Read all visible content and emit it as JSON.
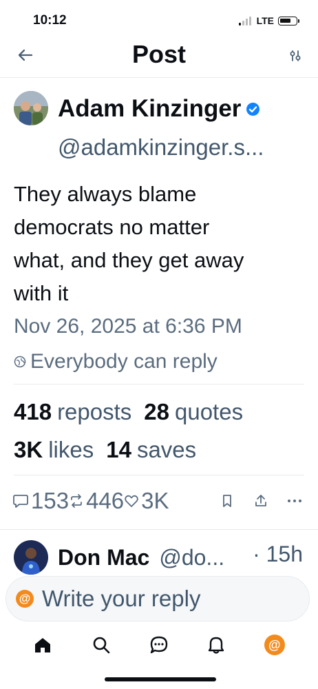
{
  "status_bar": {
    "time": "10:12",
    "network": "LTE"
  },
  "header": {
    "title": "Post"
  },
  "post": {
    "author_name": "Adam Kinzinger",
    "handle": "@adamkinzinger.s...",
    "text_lines": [
      "They always blame",
      "democrats no matter",
      "what, and they get away",
      "with it"
    ],
    "timestamp": "Nov 26, 2025 at 6:36 PM",
    "reply_permission": "Everybody can reply"
  },
  "stats": {
    "reposts_count": "418",
    "reposts_label": "reposts",
    "quotes_count": "28",
    "quotes_label": "quotes",
    "likes_count": "3K",
    "likes_label": "likes",
    "saves_count": "14",
    "saves_label": "saves"
  },
  "actions": {
    "replies": "153",
    "reposts": "446",
    "likes": "3K"
  },
  "reply_preview": {
    "name": "Don Mac",
    "handle": "@do...",
    "time": "· 15h"
  },
  "composer": {
    "placeholder": "Write your reply",
    "icon_glyph": "@"
  },
  "tabbar": {
    "profile_glyph": "@"
  },
  "colors": {
    "accent": "#1083fe",
    "orange": "#f28b1e",
    "muted": "#42576c"
  }
}
